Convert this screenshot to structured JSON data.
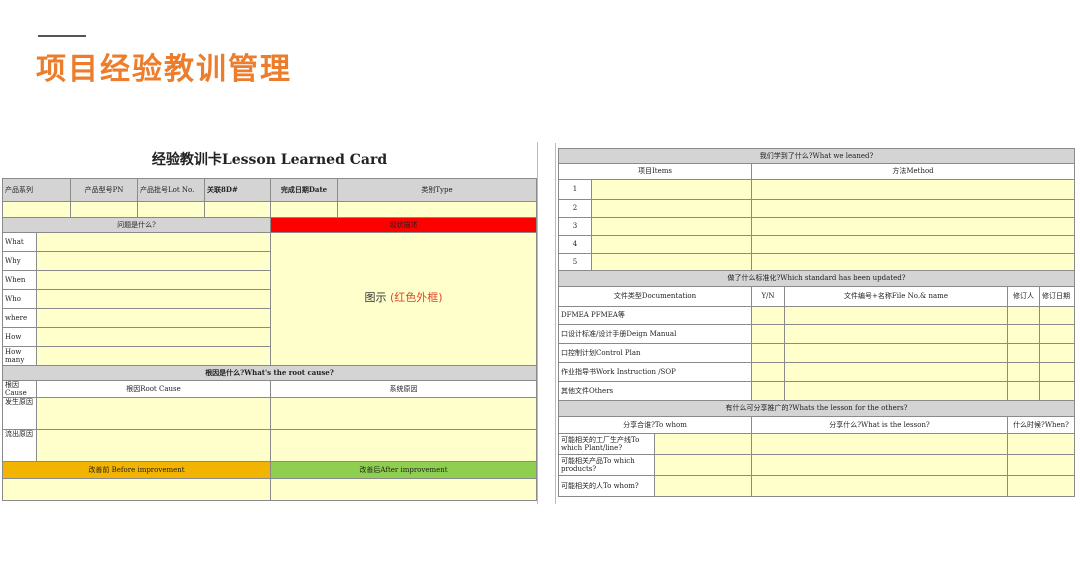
{
  "header": {
    "title": "项目经验教训管理"
  },
  "left_card": {
    "title": "经验教训卡Lesson Learned Card",
    "info_headers": [
      "产品系列",
      "产品型号PN",
      "产品批号Lot No.",
      "关联8D#",
      "完成日期Date",
      "类别Type"
    ],
    "what_section": "问题是什么?",
    "diagram_section": "现状描述",
    "questions": [
      "What",
      "Why",
      "When",
      "Who",
      "where",
      "How",
      "How many"
    ],
    "diagram_text": "图示",
    "diagram_note": "(红色外框)",
    "root_cause_section": "根因是什么?What's the root cause?",
    "root_cause_label": "根因Cause",
    "root_cause_col": "根因Root Cause",
    "system_cause_col": "系统原因",
    "occur_cause": "发生原因",
    "outflow_cause": "流出原因",
    "before_improvement": "改善前  Before improvement",
    "after_improvement": "改善后After improvement"
  },
  "right_card": {
    "learned_section": "我们学到了什么?What we leaned?",
    "items_col": "项目Items",
    "method_col": "方法Method",
    "rows": [
      "1",
      "2",
      "3",
      "4",
      "5"
    ],
    "standard_section": "做了什么标准化?Which standard has been updated?",
    "doc_type_col": "文件类型Documentation",
    "yn_col": "Y/N",
    "doc_no_col": "文件编号+名称File No.& name",
    "reviser_col": "修订人",
    "revise_date_col": "修订日期",
    "documents": [
      "DFMEA PFMEA等",
      "口设计标准/设计手册Deign Manual",
      "口控制计划Control Plan",
      "作业指导书Work Instruction /SOP",
      "其他文件Others"
    ],
    "share_section": "有什么可分享推广的?Whats the lesson for the others?",
    "share_to_col": "分享合谁?To whom",
    "share_what_col": "分享什么?What is the lesson?",
    "share_when_col": "什么时候?When?",
    "share_rows": [
      "可能相关的工厂生产线To which Plant/line?",
      "可能相关产品To which products?",
      "可能相关的人To whom?"
    ]
  }
}
